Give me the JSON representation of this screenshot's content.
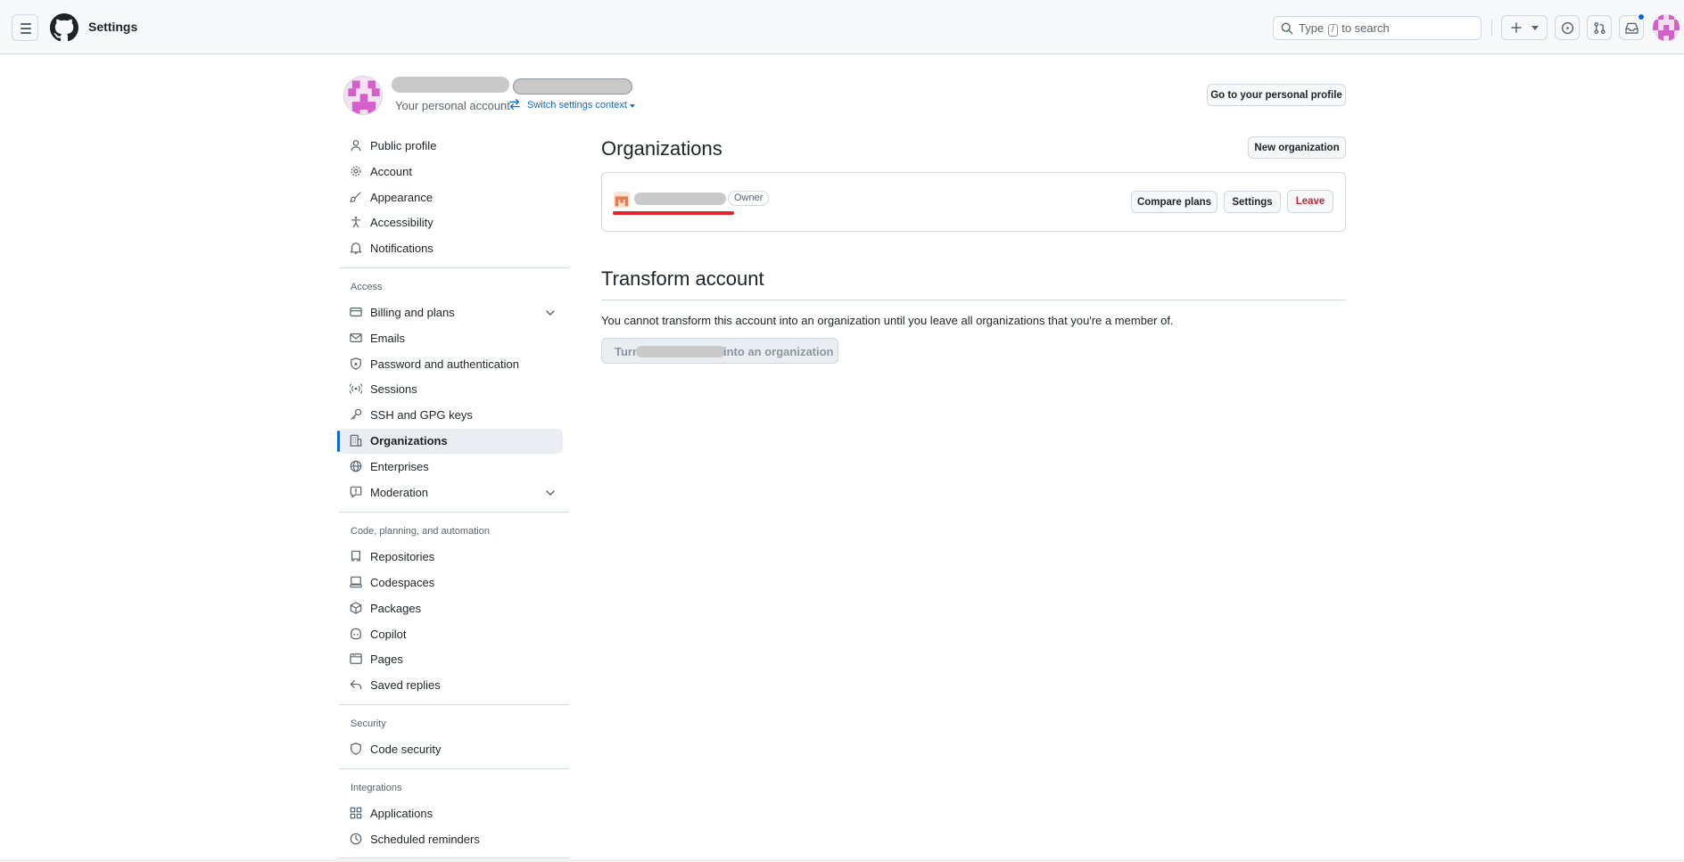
{
  "header": {
    "title": "Settings",
    "search_prefix": "Type",
    "search_key": "/",
    "search_suffix": "to search"
  },
  "profile": {
    "account_type": "Your personal account",
    "switch_context": "Switch settings context",
    "go_to_profile": "Go to your personal profile"
  },
  "sidebar": {
    "items": [
      {
        "label": "Public profile",
        "icon": "person-icon"
      },
      {
        "label": "Account",
        "icon": "gear-icon"
      },
      {
        "label": "Appearance",
        "icon": "paintbrush-icon"
      },
      {
        "label": "Accessibility",
        "icon": "accessibility-icon"
      },
      {
        "label": "Notifications",
        "icon": "bell-icon"
      }
    ],
    "access_heading": "Access",
    "access_items": [
      {
        "label": "Billing and plans",
        "icon": "credit-card-icon"
      },
      {
        "label": "Emails",
        "icon": "mail-icon"
      },
      {
        "label": "Password and authentication",
        "icon": "shield-lock-icon"
      },
      {
        "label": "Sessions",
        "icon": "broadcast-icon"
      },
      {
        "label": "SSH and GPG keys",
        "icon": "key-icon"
      },
      {
        "label": "Organizations",
        "icon": "organization-icon",
        "active": true
      },
      {
        "label": "Enterprises",
        "icon": "globe-icon"
      },
      {
        "label": "Moderation",
        "icon": "report-icon"
      }
    ],
    "code_heading": "Code, planning, and automation",
    "code_items": [
      {
        "label": "Repositories",
        "icon": "repo-icon"
      },
      {
        "label": "Codespaces",
        "icon": "codespaces-icon"
      },
      {
        "label": "Packages",
        "icon": "package-icon"
      },
      {
        "label": "Copilot",
        "icon": "copilot-icon"
      },
      {
        "label": "Pages",
        "icon": "browser-icon"
      },
      {
        "label": "Saved replies",
        "icon": "reply-icon"
      }
    ],
    "security_heading": "Security",
    "security_items": [
      {
        "label": "Code security",
        "icon": "shield-icon"
      }
    ],
    "integrations_heading": "Integrations",
    "integrations_items": [
      {
        "label": "Applications",
        "icon": "apps-icon"
      },
      {
        "label": "Scheduled reminders",
        "icon": "clock-icon"
      }
    ]
  },
  "main": {
    "organizations_title": "Organizations",
    "new_org_button": "New organization",
    "org": {
      "role_badge": "Owner",
      "compare_plans": "Compare plans",
      "settings": "Settings",
      "leave": "Leave"
    },
    "transform_title": "Transform account",
    "transform_desc": "You cannot transform this account into an organization until you leave all organizations that you're a member of.",
    "transform_btn_prefix": "Turn",
    "transform_btn_suffix": "into an organization"
  },
  "colors": {
    "accent": "#0969da",
    "danger": "#d1242f",
    "redaction": "#c9c9c9",
    "annotation_red": "#e5202d"
  }
}
